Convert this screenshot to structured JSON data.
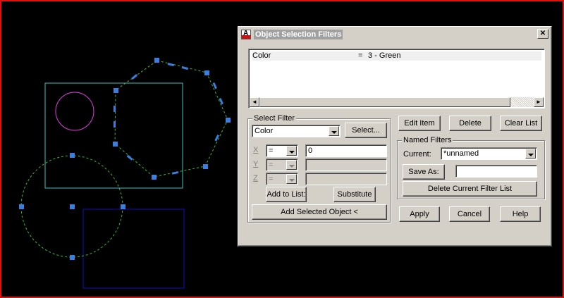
{
  "dialog": {
    "title": "Object Selection Filters",
    "close_glyph": "✕",
    "app_icon_letter": "A"
  },
  "filter_list": {
    "rows": [
      {
        "property": "Color",
        "operator": "=",
        "value": "3 - Green"
      }
    ],
    "scroll_left": "◄",
    "scroll_right": "►"
  },
  "select_filter": {
    "legend": "Select Filter",
    "filter_type": "Color",
    "select_button": "Select...",
    "axes": [
      {
        "label": "X",
        "operator": "=",
        "value": "0",
        "enabled": true
      },
      {
        "label": "Y",
        "operator": "=",
        "value": "",
        "enabled": false
      },
      {
        "label": "Z",
        "operator": "=",
        "value": "",
        "enabled": false
      }
    ],
    "add_to_list_button": "Add to List:",
    "substitute_button": "Substitute",
    "add_selected_button": "Add Selected Object <"
  },
  "list_buttons": {
    "edit_item": "Edit Item",
    "delete": "Delete",
    "clear_list": "Clear List"
  },
  "named_filters": {
    "legend": "Named Filters",
    "current_label": "Current:",
    "current_value": "*unnamed",
    "save_as_button": "Save As:",
    "save_as_value": "",
    "delete_current_button": "Delete Current Filter List"
  },
  "footer": {
    "apply": "Apply",
    "cancel": "Cancel",
    "help": "Help"
  },
  "drawing": {
    "colors": {
      "background": "#000000",
      "frame": "#e01010",
      "cyan_rect": "#40c0c0",
      "magenta_circle": "#e040e0",
      "green_dashed": "#30c030",
      "blue_rect": "#1010c0",
      "grip": "#3a7ee0"
    }
  }
}
